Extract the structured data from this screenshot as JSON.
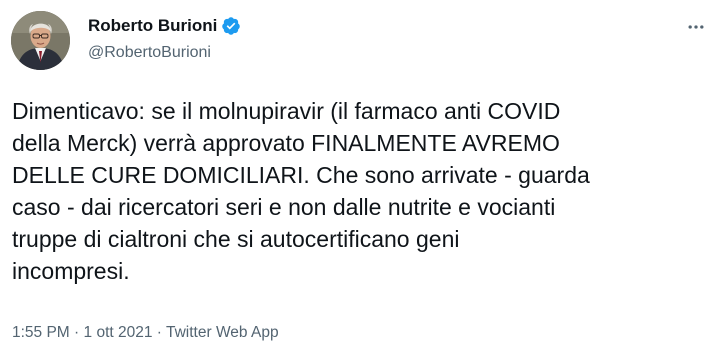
{
  "author": {
    "display_name": "Roberto Burioni",
    "handle": "@RobertoBurioni",
    "verified": true
  },
  "icons": {
    "avatar": "avatar",
    "verified": "verified-badge-icon",
    "more": "more-horizontal-icon"
  },
  "colors": {
    "verified_badge": "#1d9bf0",
    "secondary_text": "#536471",
    "primary_text": "#0f1419"
  },
  "tweet": {
    "text": "Dimenticavo: se il molnupiravir (il farmaco anti COVID\ndella Merck) verrà approvato FINALMENTE AVREMO\nDELLE CURE DOMICILIARI. Che sono arrivate - guarda\ncaso - dai ricercatori seri e non dalle nutrite e vocianti\ntruppe di cialtroni che si autocertificano geni\nincompresi.",
    "time": "1:55 PM",
    "separator": "·",
    "date": "1 ott 2021",
    "source": "Twitter Web App"
  }
}
